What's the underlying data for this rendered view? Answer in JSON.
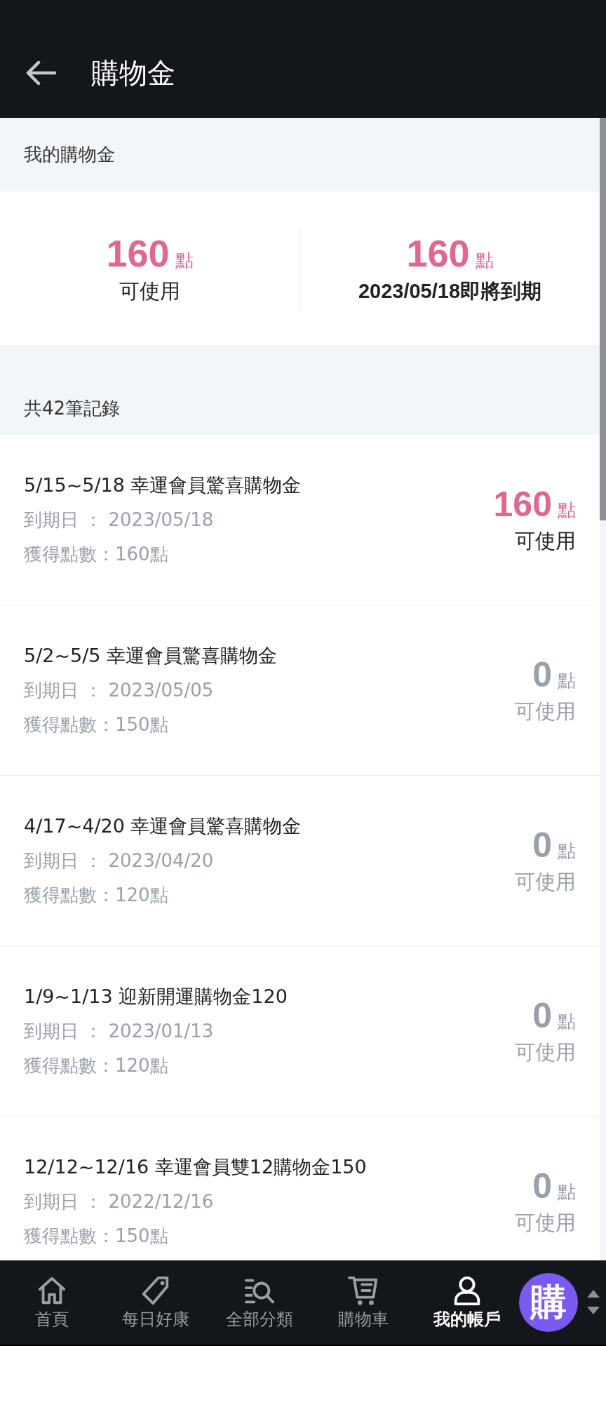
{
  "header": {
    "title": "購物金"
  },
  "summary": {
    "heading": "我的購物金",
    "cards": [
      {
        "amount": "160",
        "unit": "點",
        "label": "可使用",
        "bold": false
      },
      {
        "amount": "160",
        "unit": "點",
        "label": "2023/05/18即將到期",
        "bold": true
      }
    ]
  },
  "records": {
    "count_label": "共42筆記錄",
    "items": [
      {
        "title": "5/15~5/18 幸運會員驚喜購物金",
        "expiry": "到期日 ： 2023/05/18",
        "earned": "獲得點數：160點",
        "amount": "160",
        "unit": "點",
        "status": "可使用",
        "active": true
      },
      {
        "title": "5/2~5/5 幸運會員驚喜購物金",
        "expiry": "到期日 ： 2023/05/05",
        "earned": "獲得點數：150點",
        "amount": "0",
        "unit": "點",
        "status": "可使用",
        "active": false
      },
      {
        "title": "4/17~4/20 幸運會員驚喜購物金",
        "expiry": "到期日 ： 2023/04/20",
        "earned": "獲得點數：120點",
        "amount": "0",
        "unit": "點",
        "status": "可使用",
        "active": false
      },
      {
        "title": "1/9~1/13 迎新開運購物金120",
        "expiry": "到期日 ： 2023/01/13",
        "earned": "獲得點數：120點",
        "amount": "0",
        "unit": "點",
        "status": "可使用",
        "active": false
      },
      {
        "title": "12/12~12/16 幸運會員雙12購物金150",
        "expiry": "到期日 ： 2022/12/16",
        "earned": "獲得點數：150點",
        "amount": "0",
        "unit": "點",
        "status": "可使用",
        "active": false
      }
    ]
  },
  "bottom_nav": {
    "items": [
      {
        "kind": "home",
        "label": "首頁",
        "selected": false
      },
      {
        "kind": "tag",
        "label": "每日好康",
        "selected": false
      },
      {
        "kind": "categories",
        "label": "全部分類",
        "selected": false
      },
      {
        "kind": "cart",
        "label": "購物車",
        "selected": false
      },
      {
        "kind": "account",
        "label": "我的帳戶",
        "selected": true
      }
    ],
    "badge": "購"
  }
}
